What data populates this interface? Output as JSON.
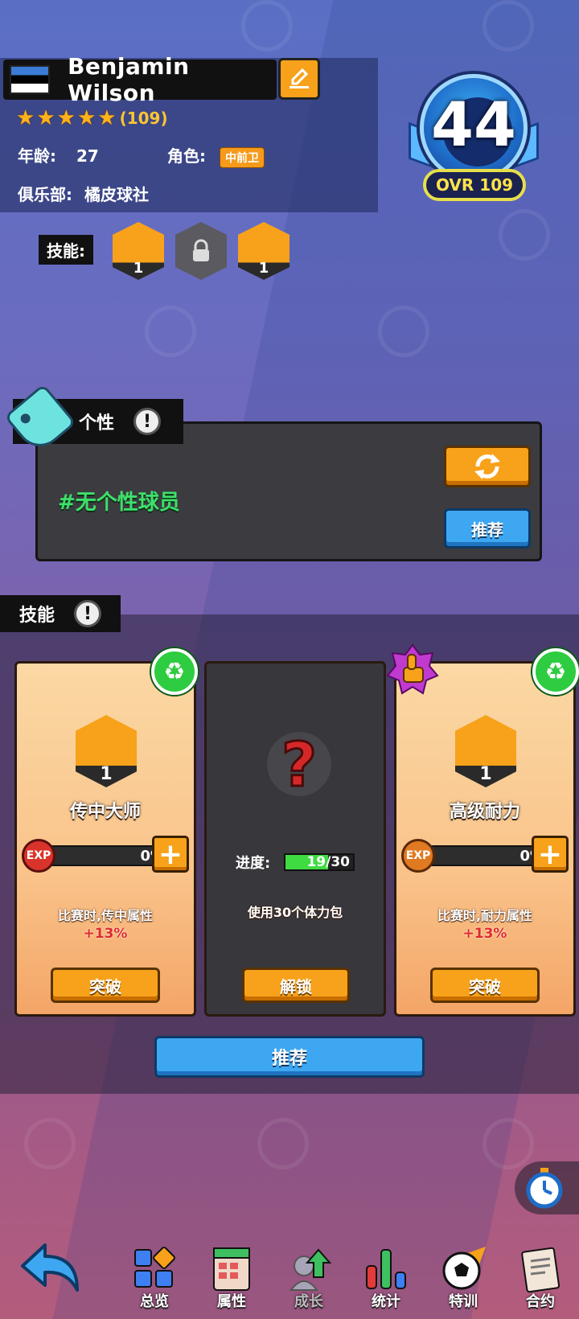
{
  "player": {
    "name": "Benjamin Wilson",
    "stars": 5,
    "rating_count": "(109)",
    "age_label": "年龄:",
    "age_value": "27",
    "role_label": "角色:",
    "role_value": "中前卫",
    "club_label": "俱乐部:",
    "club_value": "橘皮球社",
    "skills_label": "技能:",
    "skill_levels": [
      "1",
      "1"
    ],
    "ovr_number": "44",
    "ovr_text": "OVR 109"
  },
  "personality": {
    "tab_label": "个性",
    "info": "!",
    "value": "#无个性球员",
    "recommend_label": "推荐"
  },
  "skills": {
    "tab_label": "技能",
    "info": "!",
    "cards": [
      {
        "name": "传中大师",
        "level": "1",
        "exp_label": "EXP",
        "exp_pct": "0%",
        "desc": "比赛时,传中属性",
        "bonus": "+13%",
        "button": "突破"
      },
      {
        "progress_label": "进度:",
        "progress_value": "19/30",
        "progress_fraction": 0.633,
        "desc": "使用30个体力包",
        "button": "解锁"
      },
      {
        "name": "高级耐力",
        "level": "1",
        "exp_label": "EXP",
        "exp_pct": "0%",
        "desc": "比赛时,耐力属性",
        "bonus": "+13%",
        "button": "突破"
      }
    ],
    "recommend_label": "推荐"
  },
  "nav": {
    "items": [
      {
        "label": "总览",
        "icon": "overview-icon"
      },
      {
        "label": "属性",
        "icon": "attributes-icon"
      },
      {
        "label": "成长",
        "icon": "growth-icon"
      },
      {
        "label": "统计",
        "icon": "stats-icon"
      },
      {
        "label": "特训",
        "icon": "training-icon"
      },
      {
        "label": "合约",
        "icon": "contract-icon"
      }
    ]
  },
  "colors": {
    "accent_orange": "#f7a21a",
    "accent_blue": "#3ea7f2",
    "persona_green": "#3ee06a",
    "bonus_red": "#e02a2a"
  }
}
